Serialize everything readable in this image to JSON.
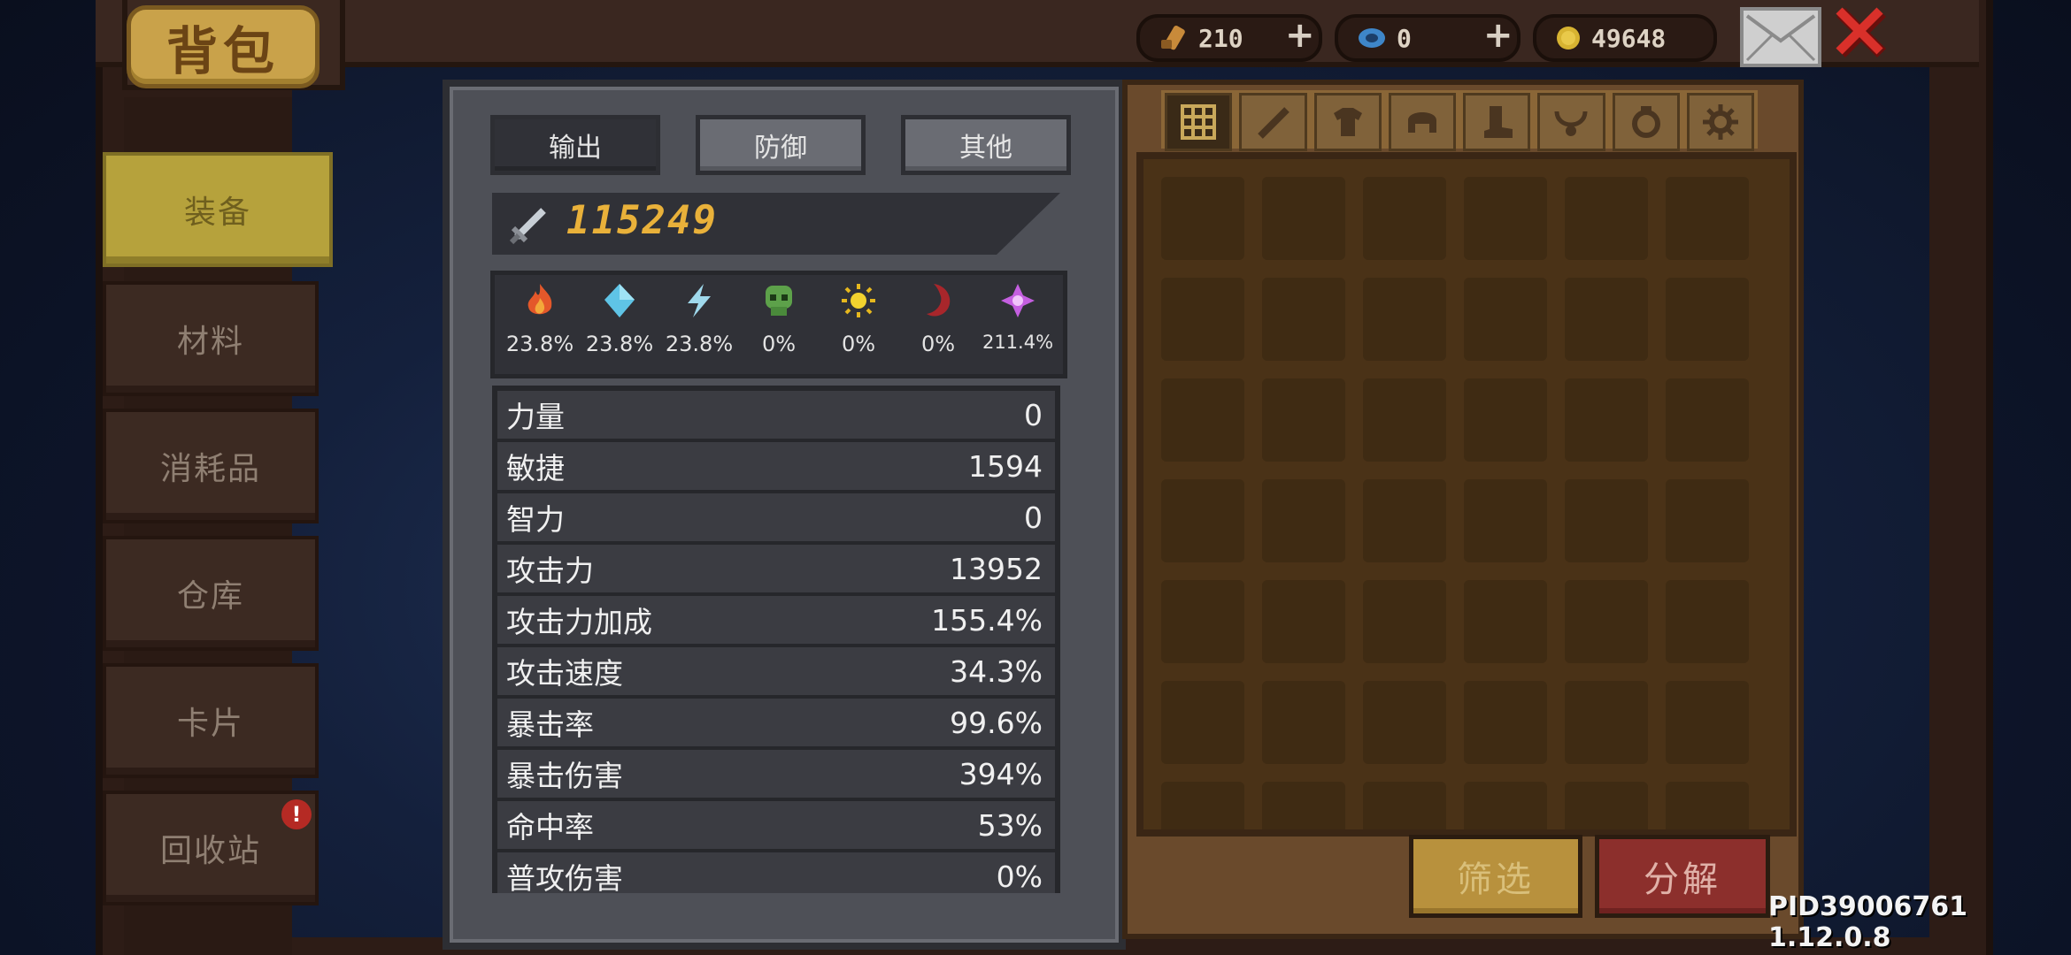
{
  "header": {
    "title": "背包",
    "currencies": [
      {
        "name": "scroll",
        "value": "210",
        "plus": "+"
      },
      {
        "name": "gem",
        "value": "0",
        "plus": "+"
      },
      {
        "name": "gold",
        "value": "49648"
      }
    ]
  },
  "sidebar": {
    "items": [
      {
        "label": "装备",
        "active": true
      },
      {
        "label": "材料"
      },
      {
        "label": "消耗品"
      },
      {
        "label": "仓库"
      },
      {
        "label": "卡片"
      },
      {
        "label": "回收站",
        "badge": "!"
      }
    ]
  },
  "stats": {
    "tabs": [
      "输出",
      "防御",
      "其他"
    ],
    "active_tab": "输出",
    "power": "115249",
    "elements": [
      {
        "icon": "fire-icon",
        "value": "23.8%"
      },
      {
        "icon": "ice-crystal-icon",
        "value": "23.8%"
      },
      {
        "icon": "lightning-icon",
        "value": "23.8%"
      },
      {
        "icon": "poison-skull-icon",
        "value": "0%"
      },
      {
        "icon": "light-sun-icon",
        "value": "0%"
      },
      {
        "icon": "dark-moon-icon",
        "value": "0%"
      },
      {
        "icon": "arcane-star-icon",
        "value": "211.4%"
      }
    ],
    "rows": [
      {
        "label": "力量",
        "value": "0"
      },
      {
        "label": "敏捷",
        "value": "1594"
      },
      {
        "label": "智力",
        "value": "0"
      },
      {
        "label": "攻击力",
        "value": "13952"
      },
      {
        "label": "攻击力加成",
        "value": "155.4%"
      },
      {
        "label": "攻击速度",
        "value": "34.3%"
      },
      {
        "label": "暴击率",
        "value": "99.6%"
      },
      {
        "label": "暴击伤害",
        "value": "394%"
      },
      {
        "label": "命中率",
        "value": "53%"
      },
      {
        "label": "普攻伤害",
        "value": "0%"
      }
    ]
  },
  "inventory": {
    "filter_tabs": [
      "all-grid-icon",
      "weapon-icon",
      "armor-icon",
      "helmet-icon",
      "boots-icon",
      "necklace-icon",
      "ring-icon",
      "gear-misc-icon"
    ],
    "filter_button": "筛选",
    "decompose_button": "分解"
  },
  "footer": {
    "pid": "PID39006761 1.12.0.8"
  },
  "colors": {
    "accent_gold": "#c9a24a",
    "active_nav": "#b6a23c",
    "power_text": "#e9b13a",
    "decompose": "#8c2f2c"
  }
}
